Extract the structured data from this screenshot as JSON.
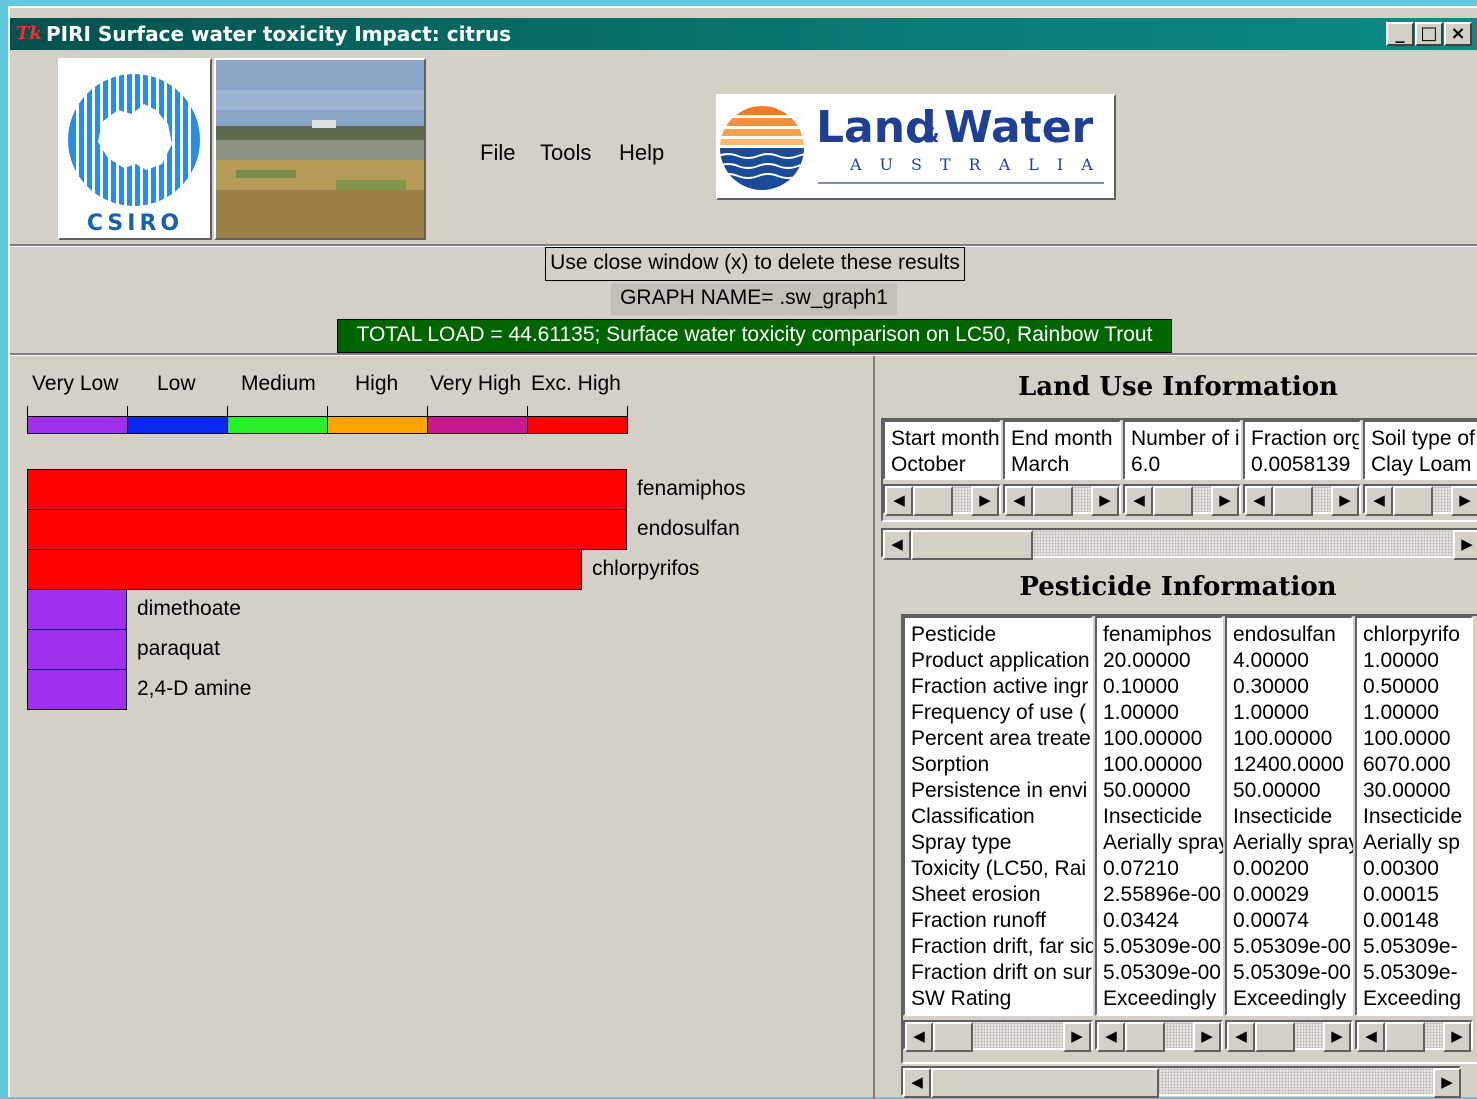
{
  "window": {
    "title": "PIRI Surface water toxicity Impact: citrus",
    "icon_glyph": "Tk",
    "buttons": [
      "_",
      "□",
      "×"
    ]
  },
  "logos": {
    "csiro": "CSIRO",
    "landwater_main": "Land",
    "landwater_amp": "&",
    "landwater_water": "Water",
    "landwater_sub": "AUSTRALIA"
  },
  "menu": {
    "items": [
      "File",
      "Tools",
      "Help"
    ]
  },
  "info": {
    "close_note": "Use close window (x) to delete these results",
    "graph_name": "GRAPH NAME= .sw_graph1",
    "total_load": "TOTAL LOAD =   44.61135; Surface water toxicity comparison on LC50, Rainbow Trout"
  },
  "legend": {
    "labels": [
      "Very Low",
      "Low",
      "Medium",
      "High",
      "Very High",
      "Exc. High"
    ],
    "colors": [
      "#a030f0",
      "#0a28f0",
      "#28f028",
      "#ffa500",
      "#c81890",
      "#ff0000"
    ]
  },
  "chart_data": {
    "type": "bar",
    "categories": [
      "fenamiphos",
      "endosulfan",
      "chlorpyrifos",
      "dimethoate",
      "paraquat",
      "2,4-D amine"
    ],
    "values": [
      6.0,
      6.0,
      5.55,
      1.0,
      1.0,
      1.0
    ],
    "colors": [
      "#ff0000",
      "#ff0000",
      "#ff0000",
      "#a030f0",
      "#a030f0",
      "#a030f0"
    ],
    "xlim": [
      0,
      6
    ]
  },
  "land_use": {
    "title": "Land Use Information",
    "columns": [
      {
        "header": "Start month",
        "value": "October"
      },
      {
        "header": "End month",
        "value": "March"
      },
      {
        "header": "Number of i",
        "value": "6.0"
      },
      {
        "header": "Fraction org",
        "value": "0.0058139"
      },
      {
        "header": "Soil type of",
        "value": "Clay Loam"
      }
    ]
  },
  "pesticide": {
    "title": "Pesticide Information",
    "rows": [
      "Pesticide",
      "Product application",
      "Fraction active ingr",
      "Frequency of use (",
      "Percent area treate",
      "Sorption",
      "Persistence in envi",
      "Classification",
      "Spray type",
      "Toxicity (LC50, Rai",
      "Sheet erosion",
      "Fraction runoff",
      "Fraction drift, far sid",
      "Fraction drift on sur",
      "SW Rating"
    ],
    "columns": [
      [
        "fenamiphos",
        "20.00000",
        "0.10000",
        "1.00000",
        "100.00000",
        "100.00000",
        "50.00000",
        "Insecticide",
        "Aerially spray",
        "0.07210",
        "2.55896e-00",
        "0.03424",
        "5.05309e-00",
        "5.05309e-00",
        "Exceedingly"
      ],
      [
        "endosulfan",
        "4.00000",
        "0.30000",
        "1.00000",
        "100.00000",
        "12400.0000",
        "50.00000",
        "Insecticide",
        "Aerially spray",
        "0.00200",
        "0.00029",
        "0.00074",
        "5.05309e-00",
        "5.05309e-00",
        "Exceedingly"
      ],
      [
        "chlorpyrifo",
        "1.00000",
        "0.50000",
        "1.00000",
        "100.0000",
        "6070.000",
        "30.00000",
        "Insecticide",
        "Aerially sp",
        "0.00300",
        "0.00015",
        "0.00148",
        "5.05309e-",
        "5.05309e-",
        "Exceeding"
      ]
    ]
  }
}
